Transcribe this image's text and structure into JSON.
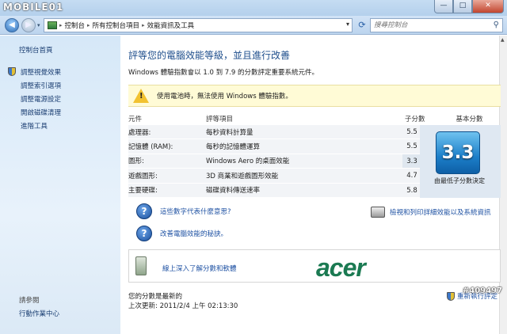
{
  "window": {
    "watermark_logo": "MOBILE01",
    "minimize": "—",
    "maximize": "□",
    "close": "✕",
    "post_id": "#409497"
  },
  "address": {
    "crumbs": [
      "控制台",
      "所有控制台項目",
      "效能資訊及工具"
    ],
    "search_placeholder": "搜尋控制台"
  },
  "sidebar": {
    "home": "控制台首頁",
    "items": [
      {
        "label": "調整視覺效果",
        "icon": "shield-icon"
      },
      {
        "label": "調整索引選項",
        "icon": ""
      },
      {
        "label": "調整電源設定",
        "icon": ""
      },
      {
        "label": "開啟磁碟清理",
        "icon": ""
      },
      {
        "label": "進階工具",
        "icon": ""
      }
    ],
    "see_also": "請參閱",
    "action_center": "行動作業中心"
  },
  "main": {
    "heading": "評等您的電腦效能等級，並且進行改善",
    "description": "Windows 體驗指數會以 1.0 到 7.9 的分數評定重要系統元件。",
    "warning": "使用電池時，無法使用 Windows 體驗指數。",
    "table": {
      "headers": {
        "component": "元件",
        "item": "評等項目",
        "subscore": "子分數",
        "basescore": "基本分數"
      },
      "rows": [
        {
          "component": "處理器:",
          "item": "每秒資料計算量",
          "subscore": "5.5"
        },
        {
          "component": "記憶體 (RAM):",
          "item": "每秒的記憶體運算",
          "subscore": "5.5"
        },
        {
          "component": "圖形:",
          "item": "Windows Aero 的桌面效能",
          "subscore": "3.3"
        },
        {
          "component": "遊戲圖形:",
          "item": "3D 商業和遊戲圖形效能",
          "subscore": "4.7"
        },
        {
          "component": "主要硬碟:",
          "item": "磁碟資料傳送速率",
          "subscore": "5.8"
        }
      ],
      "base_score": "3.3",
      "base_caption": "由最低子分數決定"
    },
    "links": {
      "what_mean": "這些數字代表什麼意思?",
      "tips": "改善電腦效能的秘訣。",
      "print": "檢視和列印詳細效能以及系統資訊"
    },
    "acer": {
      "link": "線上深入了解分數和軟體",
      "logo": "acer"
    },
    "footer": {
      "status": "您的分數是最新的",
      "last_update": "上次更新: 2011/2/4 上午 02:13:30",
      "rerun": "重新執行評定"
    }
  }
}
